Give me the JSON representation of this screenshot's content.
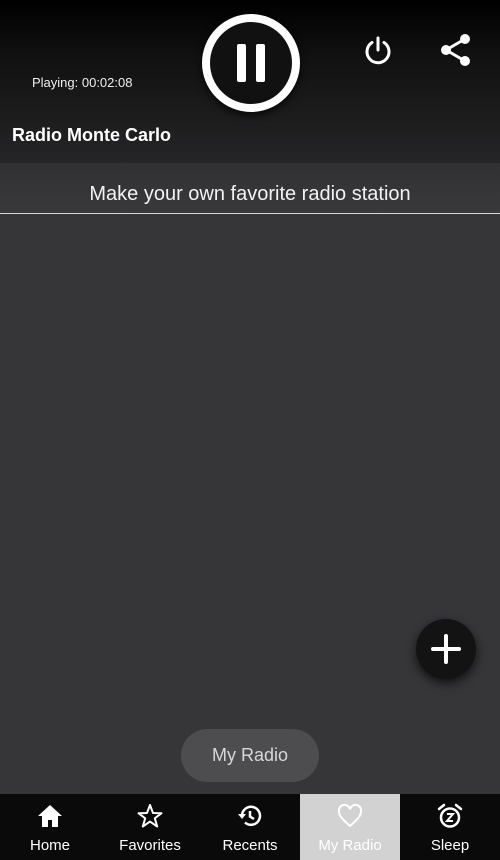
{
  "player": {
    "playing_text": "Playing: 00:02:08",
    "station_name": "Radio Monte Carlo",
    "play_state_icon": "pause-icon",
    "power_icon": "power-icon",
    "share_icon": "share-icon"
  },
  "page": {
    "heading": "Make your own favorite radio station",
    "toast": "My Radio",
    "fab_icon": "plus-icon"
  },
  "nav": {
    "items": [
      {
        "label": "Home",
        "icon": "home-icon"
      },
      {
        "label": "Favorites",
        "icon": "star-icon"
      },
      {
        "label": "Recents",
        "icon": "history-icon"
      },
      {
        "label": "My Radio",
        "icon": "heart-icon",
        "active": true
      },
      {
        "label": "Sleep",
        "icon": "alarm-icon"
      }
    ]
  },
  "colors": {
    "background": "#363538",
    "nav_background": "#0a0a0a",
    "nav_active": "#d2d2d2",
    "accent": "#ffffff"
  }
}
